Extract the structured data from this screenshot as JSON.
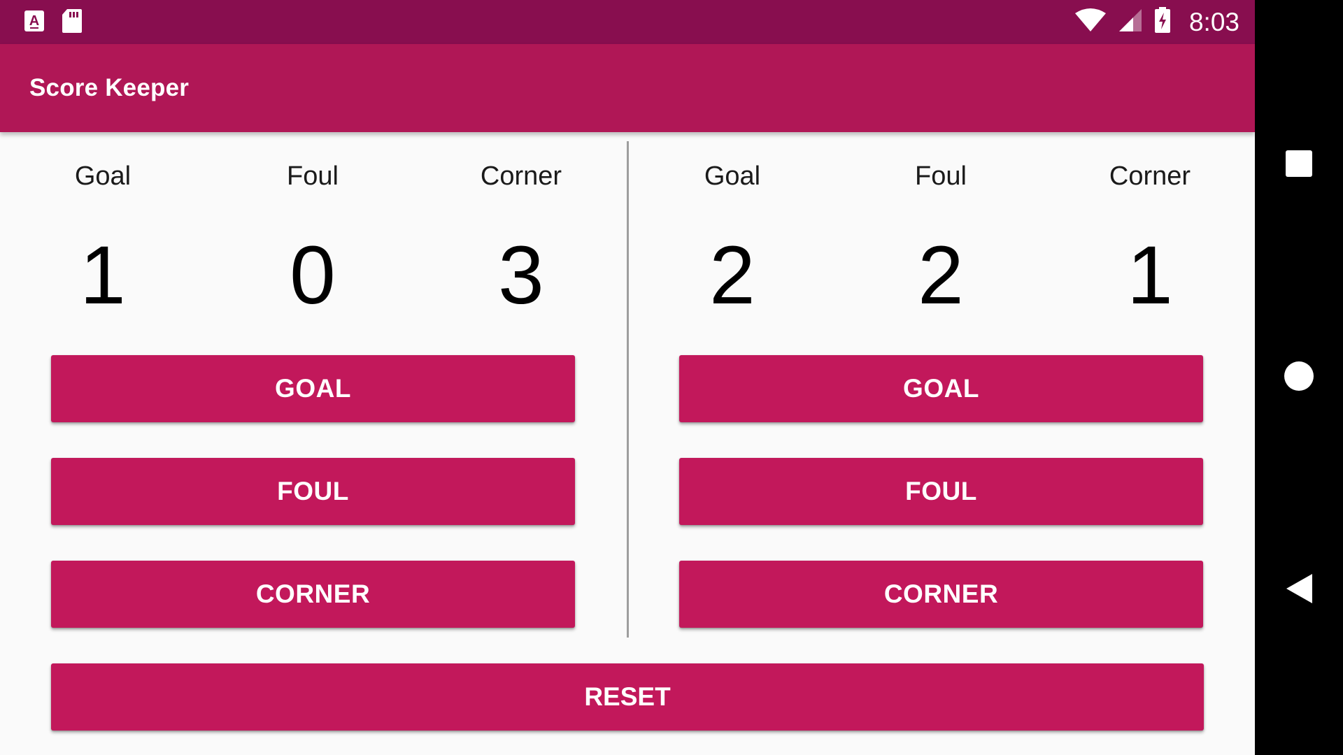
{
  "status_bar": {
    "time": "8:03",
    "left_icons": [
      "text-input-icon",
      "sd-card-icon"
    ],
    "right_icons": [
      "wifi-icon",
      "signal-icon",
      "battery-charging-icon"
    ],
    "color": "#880e4f"
  },
  "app_bar": {
    "title": "Score Keeper",
    "color": "#b01756"
  },
  "accent_color": "#c2185b",
  "team_a": {
    "stats": [
      {
        "label": "Goal",
        "value": "1"
      },
      {
        "label": "Foul",
        "value": "0"
      },
      {
        "label": "Corner",
        "value": "3"
      }
    ],
    "buttons": {
      "goal": "GOAL",
      "foul": "FOUL",
      "corner": "CORNER"
    }
  },
  "team_b": {
    "stats": [
      {
        "label": "Goal",
        "value": "2"
      },
      {
        "label": "Foul",
        "value": "2"
      },
      {
        "label": "Corner",
        "value": "1"
      }
    ],
    "buttons": {
      "goal": "GOAL",
      "foul": "FOUL",
      "corner": "CORNER"
    }
  },
  "reset_label": "RESET",
  "nav_bar": {
    "icons": [
      "recents-icon",
      "home-icon",
      "back-icon"
    ]
  }
}
